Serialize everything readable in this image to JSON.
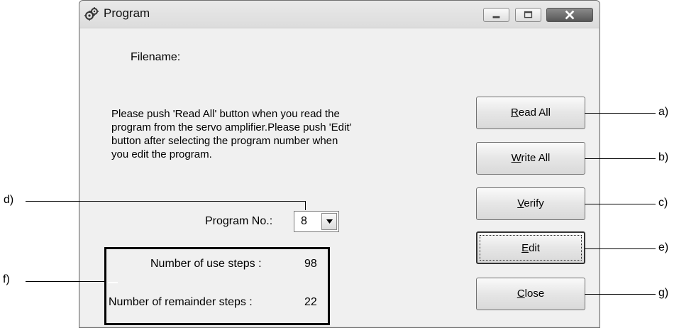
{
  "window": {
    "title": "Program",
    "icon": "gears-icon",
    "controls": [
      "minimize-icon",
      "maximize-icon",
      "close-icon"
    ]
  },
  "filename": {
    "label": "Filename:"
  },
  "instructions": {
    "lines": [
      "Please push 'Read All' button when you read the",
      "program from the servo amplifier.Please push 'Edit'",
      "button after selecting the program number when",
      "you edit the program."
    ]
  },
  "program_no": {
    "label": "Program No.:",
    "selected": "8"
  },
  "steps": {
    "use_label": "Number of use steps :",
    "use_value": "98",
    "remainder_label": "Number of remainder steps :",
    "remainder_value": "22"
  },
  "buttons": [
    {
      "accel": "R",
      "rest": "ead All"
    },
    {
      "accel": "W",
      "rest": "rite All"
    },
    {
      "accel": "V",
      "rest": "erify"
    },
    {
      "accel": "E",
      "rest": "dit"
    },
    {
      "accel": "C",
      "rest": "lose"
    }
  ],
  "callouts": {
    "a": "a)",
    "b": "b)",
    "c": "c)",
    "d": "d)",
    "e": "e)",
    "f": "f)",
    "g": "g)"
  }
}
